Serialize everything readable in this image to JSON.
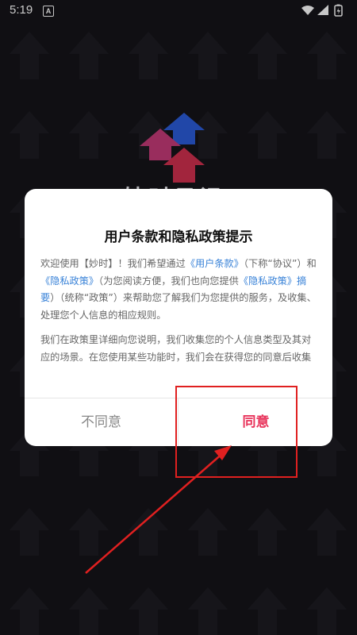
{
  "status_bar": {
    "time": "5:19",
    "notification_icon": "A",
    "icons": [
      "wifi-icon",
      "signal-icon",
      "battery-icon"
    ]
  },
  "background": {
    "app_name": "妙时日记"
  },
  "dialog": {
    "title": "用户条款和隐私政策提示",
    "p1": {
      "t1": "欢迎使用【妙时】！我们希望通过",
      "link_terms": "《用户条款》",
      "t2": "（下称“协议”）和",
      "link_privacy": "《隐私政策》",
      "t3": "（为您阅读方便，我们也向您提供",
      "link_summary": "《隐私政策》摘要",
      "t4": "）（统称“政策”）来帮助您了解我们为您提供的服务，及收集、处理您个人信息的相应规则。"
    },
    "p2": "我们在政策里详细向您说明，我们收集您的个人信息类型及其对应的场景。在您使用某些功能时，我们会在获得您的同意后收集您的个人信息。",
    "disagree_label": "不同意",
    "agree_label": "同意"
  },
  "colors": {
    "background": "#151419",
    "agree": "#e8335a",
    "link": "#3a83d8",
    "annotation": "#e02020"
  }
}
